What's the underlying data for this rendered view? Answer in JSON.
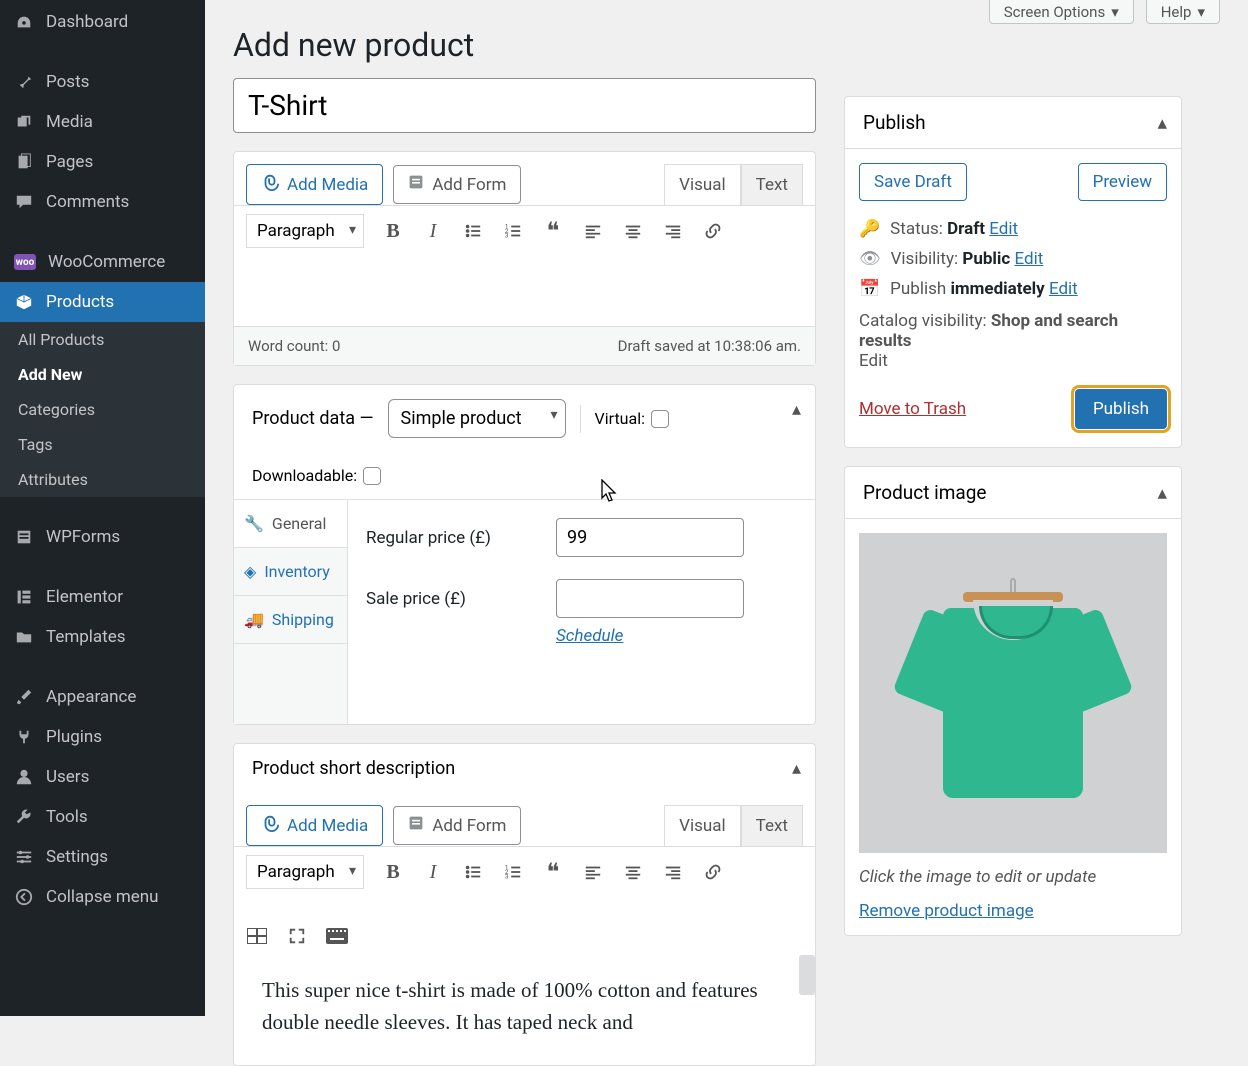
{
  "topbar": {
    "screen_options": "Screen Options",
    "help": "Help"
  },
  "page_title": "Add new product",
  "title_value": "T-Shirt",
  "sidebar": {
    "items": [
      {
        "label": "Dashboard",
        "icon": "dashboard"
      },
      {
        "label": "Posts",
        "icon": "pin"
      },
      {
        "label": "Media",
        "icon": "media"
      },
      {
        "label": "Pages",
        "icon": "pages"
      },
      {
        "label": "Comments",
        "icon": "comment"
      },
      {
        "label": "WooCommerce",
        "icon": "woo"
      },
      {
        "label": "Products",
        "icon": "box",
        "active": true
      },
      {
        "label": "WPForms",
        "icon": "forms"
      },
      {
        "label": "Elementor",
        "icon": "elementor"
      },
      {
        "label": "Templates",
        "icon": "folder"
      },
      {
        "label": "Appearance",
        "icon": "brush"
      },
      {
        "label": "Plugins",
        "icon": "plug"
      },
      {
        "label": "Users",
        "icon": "user"
      },
      {
        "label": "Tools",
        "icon": "wrench"
      },
      {
        "label": "Settings",
        "icon": "settings"
      },
      {
        "label": "Collapse menu",
        "icon": "collapse"
      }
    ],
    "submenu": [
      "All Products",
      "Add New",
      "Categories",
      "Tags",
      "Attributes"
    ],
    "submenu_current": "Add New"
  },
  "editor": {
    "add_media": "Add Media",
    "add_form": "Add Form",
    "visual": "Visual",
    "text": "Text",
    "format": "Paragraph",
    "word_count": "Word count: 0",
    "draft_saved": "Draft saved at 10:38:06 am."
  },
  "product_data": {
    "title": "Product data —",
    "type": "Simple product",
    "virtual_label": "Virtual:",
    "downloadable_label": "Downloadable:",
    "tabs": [
      "General",
      "Inventory",
      "Shipping"
    ],
    "current_tab": "General",
    "regular_price_label": "Regular price (£)",
    "regular_price_value": "99",
    "sale_price_label": "Sale price (£)",
    "sale_price_value": "",
    "schedule": "Schedule"
  },
  "short_desc": {
    "title": "Product short description",
    "body": "This super nice t-shirt is made of 100% cotton and features double needle sleeves. It has taped neck and"
  },
  "publish": {
    "title": "Publish",
    "save_draft": "Save Draft",
    "preview": "Preview",
    "status_label": "Status:",
    "status_value": "Draft",
    "visibility_label": "Visibility:",
    "visibility_value": "Public",
    "publish_label": "Publish",
    "publish_value": "immediately",
    "edit": "Edit",
    "catalog_label": "Catalog visibility:",
    "catalog_value": "Shop and search results",
    "trash": "Move to Trash",
    "publish_btn": "Publish"
  },
  "product_image": {
    "title": "Product image",
    "caption": "Click the image to edit or update",
    "remove": "Remove product image"
  }
}
